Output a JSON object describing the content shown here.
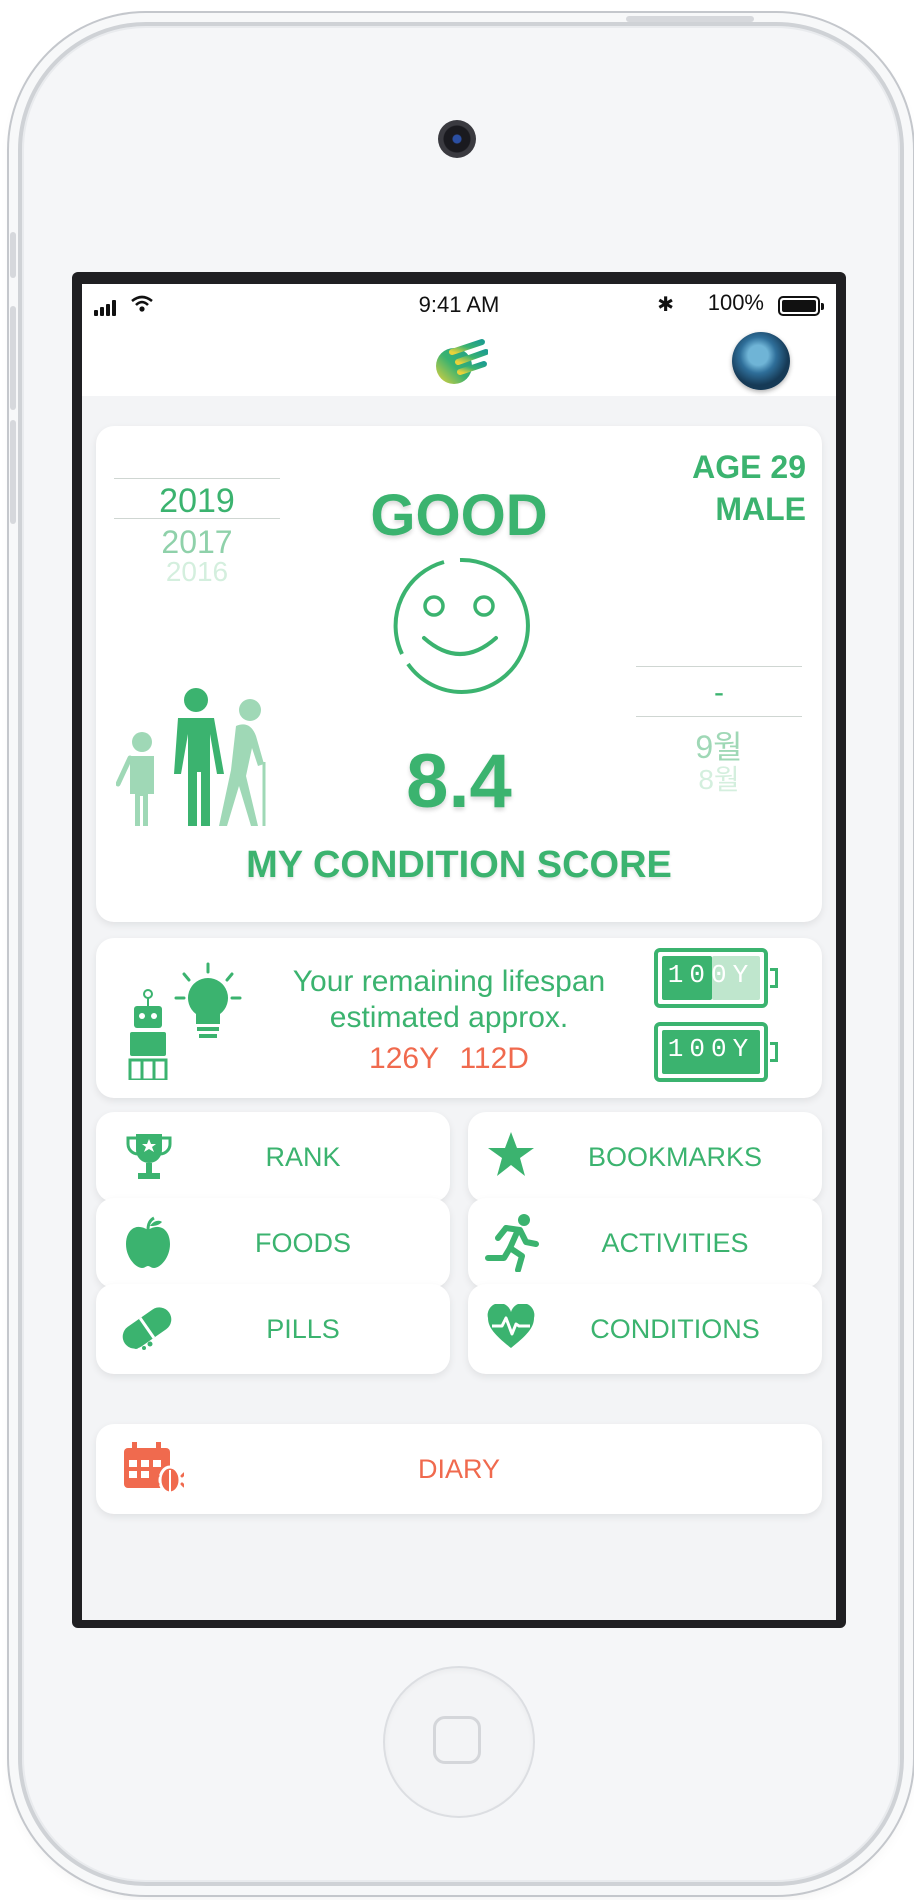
{
  "status_bar": {
    "time": "9:41 AM",
    "battery_percent": "100%",
    "bluetooth_icon": "bluetooth-icon"
  },
  "header": {
    "logo_icon": "app-logo",
    "avatar_icon": "user-avatar"
  },
  "condition": {
    "years": {
      "selected": "2019",
      "prev1": "2017",
      "prev2": "2016"
    },
    "status": "GOOD",
    "age_label": "AGE 29",
    "gender": "MALE",
    "month_selected": "-",
    "month_prev1": "9월",
    "month_prev2": "8월",
    "score": "8.4",
    "score_label": "MY CONDITION SCORE"
  },
  "lifespan": {
    "line1": "Your remaining lifespan",
    "line2": "estimated approx.",
    "years": "126Y",
    "days": "112D",
    "battery1_label": "100Y",
    "battery2_label": "100Y",
    "battery1_level": 0.45,
    "battery2_level": 1.0
  },
  "menu": {
    "rank": "RANK",
    "bookmarks": "BOOKMARKS",
    "foods": "FOODS",
    "activities": "ACTIVITIES",
    "pills": "PILLS",
    "conditions": "CONDITIONS",
    "diary": "DIARY"
  },
  "colors": {
    "accent_green": "#3bb36f",
    "accent_orange": "#f06a4e",
    "background": "#f3f4f6"
  }
}
